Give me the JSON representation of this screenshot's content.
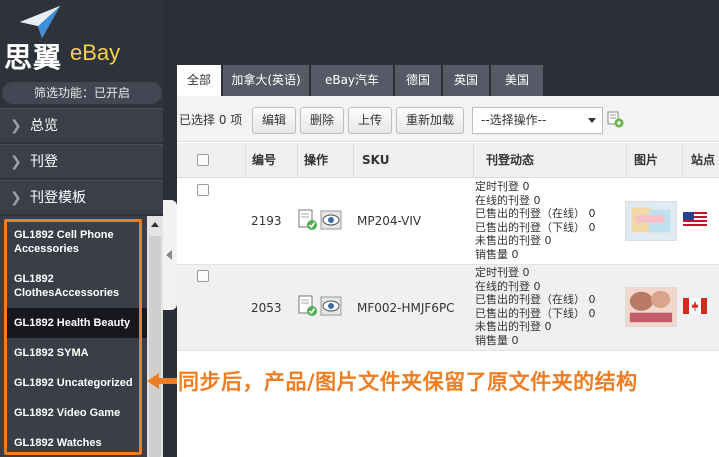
{
  "app": {
    "logo_cn": "思翼",
    "logo_en": "eBay"
  },
  "sidebar": {
    "filter_status": "筛选功能：已开启",
    "nav": [
      {
        "label": "总览"
      },
      {
        "label": "刊登"
      },
      {
        "label": "刊登模板"
      }
    ],
    "folders": [
      {
        "label": "GL1892 Cell Phone Accessories",
        "active": false
      },
      {
        "label": "GL1892 ClothesAccessories",
        "active": false
      },
      {
        "label": "GL1892 Health Beauty",
        "active": true
      },
      {
        "label": "GL1892 SYMA",
        "active": false
      },
      {
        "label": "GL1892 Uncategorized",
        "active": false
      },
      {
        "label": "GL1892 Video Game",
        "active": false
      },
      {
        "label": "GL1892 Watches",
        "active": false
      }
    ]
  },
  "tabs": [
    {
      "label": "全部",
      "active": true
    },
    {
      "label": "加拿大(英语)",
      "active": false
    },
    {
      "label": "eBay汽车",
      "active": false
    },
    {
      "label": "德国",
      "active": false
    },
    {
      "label": "英国",
      "active": false
    },
    {
      "label": "美国",
      "active": false
    }
  ],
  "toolbar": {
    "selected_count": "已选择 0 项",
    "edit": "编辑",
    "delete": "删除",
    "upload": "上传",
    "reload": "重新加载",
    "action_select": "--选择操作--"
  },
  "table": {
    "columns": {
      "id": "编号",
      "ops": "操作",
      "sku": "SKU",
      "dynamics": "刊登动态",
      "image": "图片",
      "site": "站点"
    },
    "rows": [
      {
        "id": "2193",
        "sku": "MP204-VIV",
        "site_flag": "us",
        "stats": [
          "定时刊登  0",
          "在线的刊登  0",
          "已售出的刊登（在线）  0",
          "已售出的刊登（下线）  0",
          "未售出的刊登  0",
          "销售量  0"
        ]
      },
      {
        "id": "2053",
        "sku": "MF002-HMJF6PC",
        "site_flag": "ca",
        "stats": [
          "定时刊登  0",
          "在线的刊登  0",
          "已售出的刊登（在线）  0",
          "已售出的刊登（下线）  0",
          "未售出的刊登  0",
          "销售量  0"
        ]
      }
    ]
  },
  "callout": {
    "text": "同步后，产品/图片文件夹保留了原文件夹的结构",
    "color": "#ef7d22"
  }
}
